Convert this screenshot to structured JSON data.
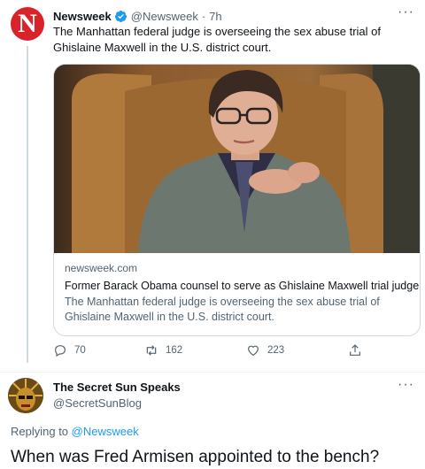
{
  "colors": {
    "accent": "#1d9bf0",
    "secondary_text": "#536471",
    "brand_red": "#d8232a"
  },
  "tweet": {
    "avatar_letter": "N",
    "author_name": "Newsweek",
    "handle": "@Newsweek",
    "separator": "·",
    "time": "7h",
    "text": "The Manhattan federal judge is overseeing the sex abuse trial of Ghislaine Maxwell in the U.S. district court.",
    "card": {
      "domain": "newsweek.com",
      "title": "Former Barack Obama counsel to serve as Ghislaine Maxwell trial judge",
      "description": "The Manhattan federal judge is overseeing the sex abuse trial of Ghislaine Maxwell in the U.S. district court."
    },
    "actions": {
      "reply_count": "70",
      "retweet_count": "162",
      "like_count": "223"
    }
  },
  "reply": {
    "author_name": "The Secret Sun Speaks",
    "handle": "@SecretSunBlog",
    "replying_prefix": "Replying to ",
    "replying_to": "@Newsweek",
    "text": "When was Fred Armisen appointed to the bench?"
  }
}
